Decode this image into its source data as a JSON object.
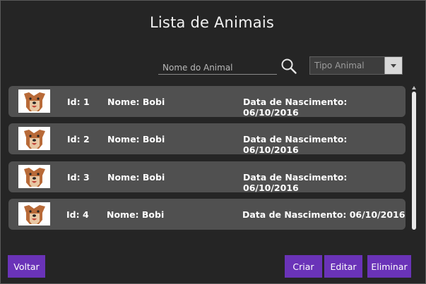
{
  "page": {
    "title": "Lista de Animais"
  },
  "filters": {
    "search_placeholder": "Nome do Animal",
    "search_value": "",
    "search_icon": "search-icon",
    "type_select_value": "Tipo Animal",
    "type_select_icon": "chevron-down-icon"
  },
  "animals": [
    {
      "id": "Id: 1",
      "name": "Nome: Bobi",
      "birth": "Data de Nascimento: 06/10/2016",
      "thumbnail": "dog-photo"
    },
    {
      "id": "Id: 2",
      "name": "Nome: Bobi",
      "birth": "Data de Nascimento: 06/10/2016",
      "thumbnail": "dog-photo"
    },
    {
      "id": "Id: 3",
      "name": "Nome: Bobi",
      "birth": "Data de Nascimento: 06/10/2016",
      "thumbnail": "dog-photo"
    },
    {
      "id": "Id: 4",
      "name": "Nome: Bobi",
      "birth": "Data de Nascimento: 06/10/2016",
      "thumbnail": "dog-photo"
    }
  ],
  "actions": {
    "back_label": "Voltar",
    "create_label": "Criar",
    "edit_label": "Editar",
    "delete_label": "Eliminar"
  },
  "colors": {
    "background": "#252525",
    "row": "#505050",
    "accent": "#6a33b8"
  }
}
